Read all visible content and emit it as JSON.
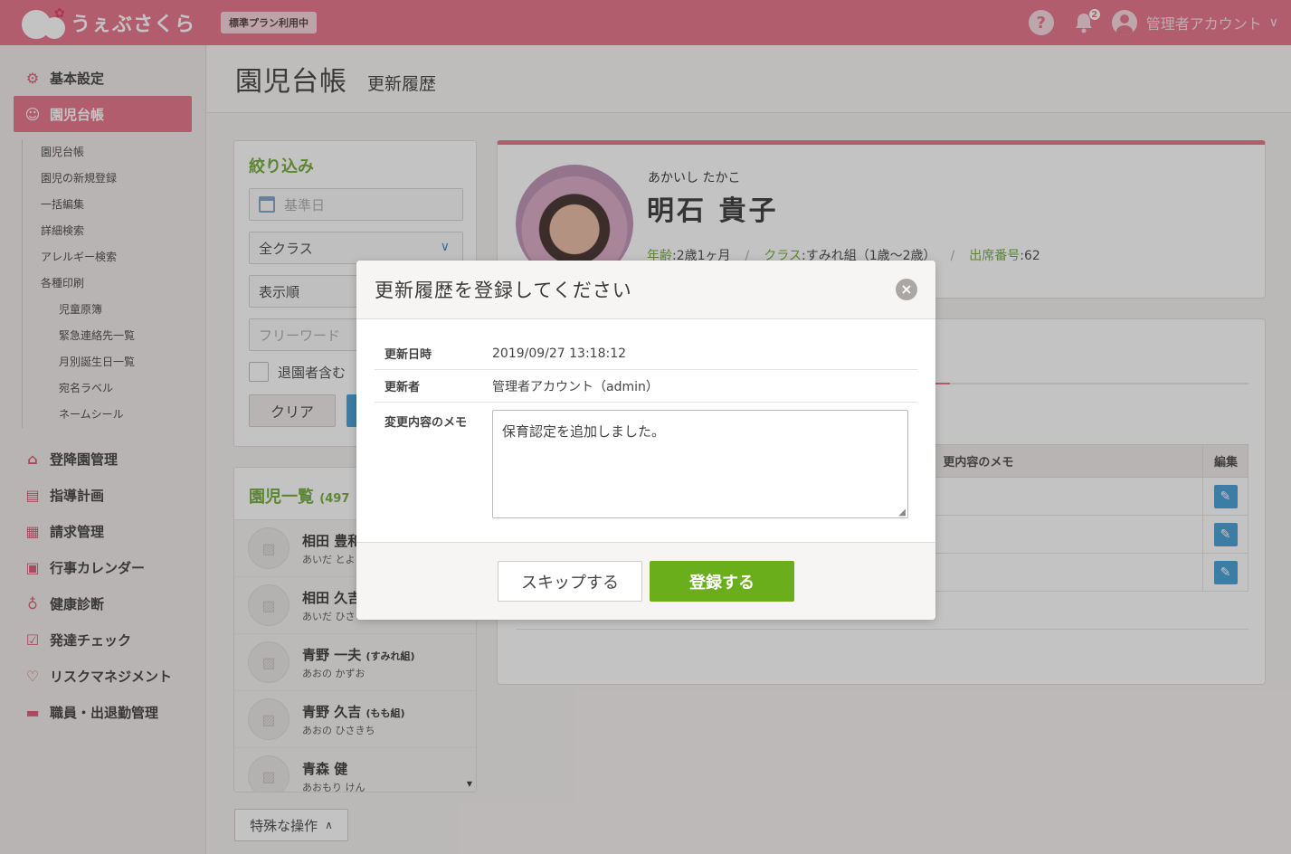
{
  "header": {
    "logo_text": "うぇぶさくら",
    "plan_badge": "標準プラン利用中",
    "notification_count": "2",
    "account_name": "管理者アカウント",
    "colors": {
      "brand": "#e46e86",
      "accent_green": "#6aae1b",
      "accent_blue": "#3d9bd6"
    }
  },
  "sidebar": {
    "items": [
      {
        "label": "基本設定",
        "icon": "gear-icon"
      },
      {
        "label": "園児台帳",
        "icon": "child-face-icon",
        "active": true
      },
      {
        "label": "登降園管理",
        "icon": "school-icon"
      },
      {
        "label": "指導計画",
        "icon": "notebook-icon"
      },
      {
        "label": "請求管理",
        "icon": "calculator-icon"
      },
      {
        "label": "行事カレンダー",
        "icon": "calendar-icon"
      },
      {
        "label": "健康診断",
        "icon": "stethoscope-icon"
      },
      {
        "label": "発達チェック",
        "icon": "checklist-icon"
      },
      {
        "label": "リスクマネジメント",
        "icon": "hands-heart-icon"
      },
      {
        "label": "職員・出退勤管理",
        "icon": "briefcase-icon"
      }
    ],
    "sub_items": [
      "園児台帳",
      "園児の新規登録",
      "一括編集",
      "詳細検索",
      "アレルギー検索",
      "各種印刷"
    ],
    "print_sub_items": [
      "児童原簿",
      "緊急連絡先一覧",
      "月別誕生日一覧",
      "宛名ラベル",
      "ネームシール"
    ]
  },
  "title_bar": {
    "title": "園児台帳",
    "subtitle": "更新履歴"
  },
  "filter": {
    "heading": "絞り込み",
    "date_placeholder": "基準日",
    "class_select": "全クラス",
    "order_select": "表示順",
    "keyword_placeholder": "フリーワード",
    "include_withdrawn_label": "退園者含む",
    "clear_label": "クリア"
  },
  "child_list": {
    "heading": "園児一覧",
    "count": "(497",
    "rows": [
      {
        "name": "相田 豊和",
        "class": "",
        "kana": "あいだ とよ"
      },
      {
        "name": "相田 久吉",
        "class": "",
        "kana": "あいだ ひさ"
      },
      {
        "name": "青野 一夫",
        "class": "(すみれ組)",
        "kana": "あおの かずお"
      },
      {
        "name": "青野 久吉",
        "class": "(もも組)",
        "kana": "あおの ひさきち"
      },
      {
        "name": "青森 健",
        "class": "",
        "kana": "あおもり けん"
      }
    ]
  },
  "special_ops_label": "特殊な操作",
  "profile": {
    "kana": "あかいし たかこ",
    "name": "明石 貴子",
    "age_label": "年齢",
    "age_value": ":2歳1ヶ月",
    "class_label": "クラス",
    "class_value": ":すみれ組（1歳〜2歳）",
    "attendance_label": "出席番号",
    "attendance_value": ":62"
  },
  "history_table": {
    "col_memo": "更内容のメモ",
    "col_edit": "編集"
  },
  "modal": {
    "title": "更新履歴を登録してください",
    "rows": [
      {
        "key": "更新日時",
        "value": "2019/09/27 13:18:12"
      },
      {
        "key": "更新者",
        "value": "管理者アカウント（admin）"
      }
    ],
    "memo_label": "変更内容のメモ",
    "memo_value": "保育認定を追加しました。",
    "skip_label": "スキップする",
    "register_label": "登録する"
  }
}
